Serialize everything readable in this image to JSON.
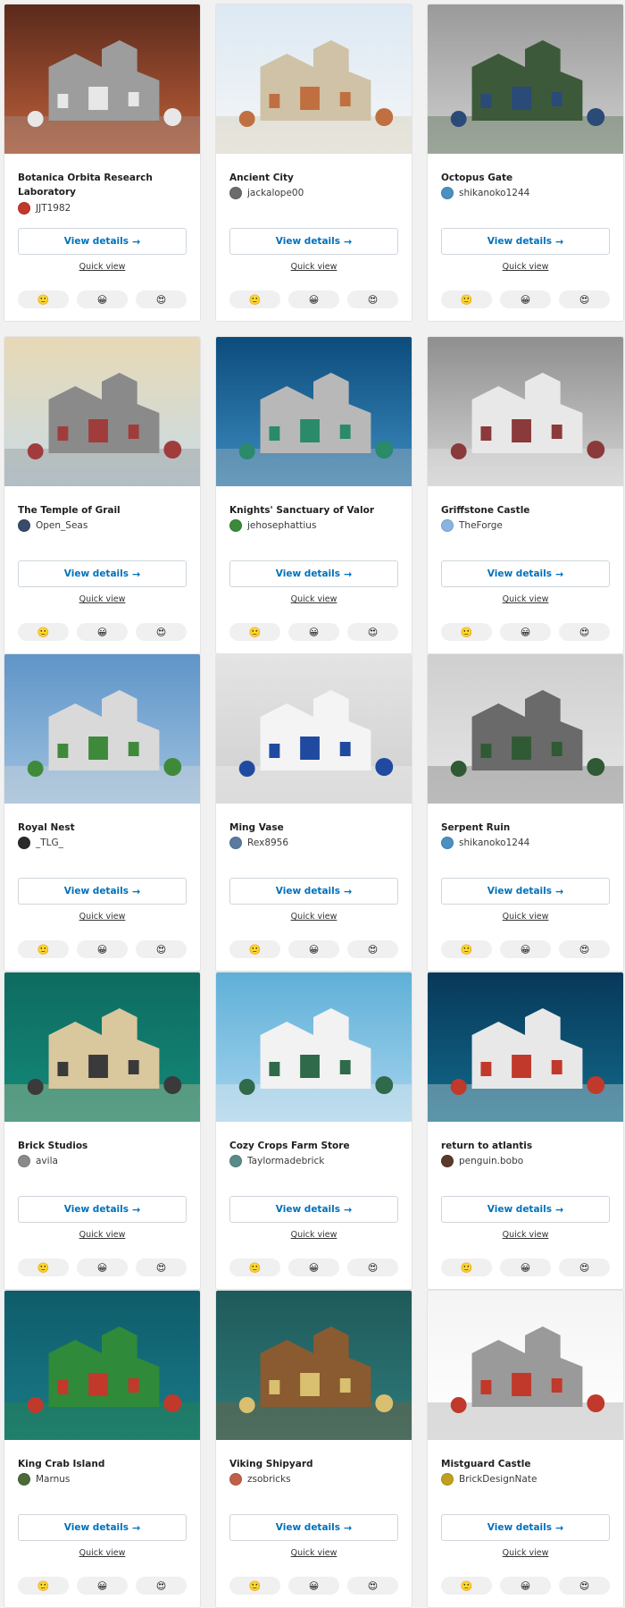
{
  "labels": {
    "view_details": "View details",
    "arrow": "→",
    "quick_view": "Quick view"
  },
  "reaction_icons": [
    "🙂",
    "😀",
    "😍"
  ],
  "products": [
    {
      "title": "Botanica Orbita Research Laboratory",
      "author": "JJT1982",
      "avatar_color": "#c0392b",
      "thumb": {
        "bg1": "#5a2a1c",
        "bg2": "#c0603a",
        "main": "#9d9d9d",
        "accent": "#e7e7e7"
      }
    },
    {
      "title": "Ancient City",
      "author": "jackalope00",
      "avatar_color": "#6b6b6b",
      "thumb": {
        "bg1": "#dde9f3",
        "bg2": "#f4f6f7",
        "main": "#cfc2a6",
        "accent": "#c07040"
      }
    },
    {
      "title": "Octopus Gate",
      "author": "shikanoko1244",
      "avatar_color": "#4a90c0",
      "thumb": {
        "bg1": "#9a9a9a",
        "bg2": "#cfcfcf",
        "main": "#3c5a3a",
        "accent": "#2a4a78"
      }
    },
    {
      "title": "The Temple of Grail",
      "author": "Open_Seas",
      "avatar_color": "#3a4a6a",
      "thumb": {
        "bg1": "#e8d9b6",
        "bg2": "#c8dbe6",
        "main": "#8a8a8a",
        "accent": "#a03c3c"
      }
    },
    {
      "title": "Knights' Sanctuary of Valor",
      "author": "jehosephattius",
      "avatar_color": "#3a8a3a",
      "thumb": {
        "bg1": "#0c4c7c",
        "bg2": "#3d8cc0",
        "main": "#b8b8b8",
        "accent": "#2a8a6a"
      }
    },
    {
      "title": "Griffstone Castle",
      "author": "TheForge",
      "avatar_color": "#8ab4e0",
      "thumb": {
        "bg1": "#8f8f8f",
        "bg2": "#d4d4d4",
        "main": "#e8e8e8",
        "accent": "#8a3a3a"
      }
    },
    {
      "title": "Royal Nest",
      "author": "_TLG_",
      "avatar_color": "#2a2a2a",
      "thumb": {
        "bg1": "#5f95c8",
        "bg2": "#9fc2e0",
        "main": "#d9d9d9",
        "accent": "#3f8a3a"
      }
    },
    {
      "title": "Ming Vase",
      "author": "Rex8956",
      "avatar_color": "#5a7aa0",
      "thumb": {
        "bg1": "#e4e4e4",
        "bg2": "#cfcfcf",
        "main": "#f4f4f4",
        "accent": "#1f4aa0"
      }
    },
    {
      "title": "Serpent Ruin",
      "author": "shikanoko1244",
      "avatar_color": "#4a90c0",
      "thumb": {
        "bg1": "#cfcfcf",
        "bg2": "#e6e6e6",
        "main": "#6a6a6a",
        "accent": "#2f5a34"
      }
    },
    {
      "title": "Brick Studios",
      "author": "avila",
      "avatar_color": "#8a8a8a",
      "thumb": {
        "bg1": "#0e6b60",
        "bg2": "#148a7a",
        "main": "#d9c79e",
        "accent": "#3a3a3a"
      }
    },
    {
      "title": "Cozy Crops Farm Store",
      "author": "Taylormadebrick",
      "avatar_color": "#5a8a8a",
      "thumb": {
        "bg1": "#5fb0d8",
        "bg2": "#a6d4ee",
        "main": "#f2f2f2",
        "accent": "#2f6a4a"
      }
    },
    {
      "title": "return to atlantis",
      "author": "penguin.bobo",
      "avatar_color": "#5a3a2a",
      "thumb": {
        "bg1": "#08385a",
        "bg2": "#126a8a",
        "main": "#e8e8e8",
        "accent": "#c0392b"
      }
    },
    {
      "title": "King Crab Island",
      "author": "Marnus",
      "avatar_color": "#4a6a3a",
      "thumb": {
        "bg1": "#0f5c6a",
        "bg2": "#1a7a88",
        "main": "#2f8a3a",
        "accent": "#c0392b"
      }
    },
    {
      "title": "Viking Shipyard",
      "author": "zsobricks",
      "avatar_color": "#c0604a",
      "thumb": {
        "bg1": "#1f5a5a",
        "bg2": "#2f7a7a",
        "main": "#8a5a30",
        "accent": "#d8c070"
      }
    },
    {
      "title": "Mistguard Castle",
      "author": "BrickDesignNate",
      "avatar_color": "#c0a020",
      "thumb": {
        "bg1": "#f4f4f4",
        "bg2": "#ffffff",
        "main": "#9a9a9a",
        "accent": "#c0392b"
      }
    }
  ]
}
